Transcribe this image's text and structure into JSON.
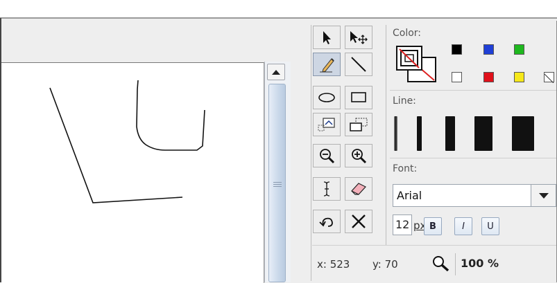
{
  "panels": {
    "color_label": "Color:",
    "line_label": "Line:",
    "font_label": "Font:"
  },
  "tools": [
    {
      "name": "select-tool",
      "icon": "arrow-pointer-icon"
    },
    {
      "name": "move-tool",
      "icon": "arrow-move-icon"
    },
    {
      "name": "pencil-tool",
      "icon": "pencil-icon",
      "active": true
    },
    {
      "name": "line-tool",
      "icon": "diagonal-line-icon"
    },
    {
      "name": "ellipse-tool",
      "icon": "ellipse-icon"
    },
    {
      "name": "rectangle-tool",
      "icon": "rectangle-icon"
    },
    {
      "name": "image-tool",
      "icon": "image-icon"
    },
    {
      "name": "duplicate-tool",
      "icon": "duplicate-icon"
    },
    {
      "name": "zoom-out-tool",
      "icon": "zoom-out-icon"
    },
    {
      "name": "zoom-in-tool",
      "icon": "zoom-in-icon"
    },
    {
      "name": "text-tool",
      "icon": "text-cursor-icon"
    },
    {
      "name": "eraser-tool",
      "icon": "eraser-icon"
    },
    {
      "name": "undo-tool",
      "icon": "undo-icon"
    },
    {
      "name": "delete-tool",
      "icon": "close-icon"
    }
  ],
  "colors": {
    "swatches": [
      "#000000",
      "#1f3fd6",
      "#1eb81e",
      "#ffffff",
      "#e0101a",
      "#f6e81a",
      "none"
    ],
    "stroke_color": "#000000",
    "fill_color": "none"
  },
  "line_widths": [
    "1",
    "2",
    "3",
    "4",
    "5"
  ],
  "font": {
    "family": "Arial",
    "size": "12",
    "unit": "px",
    "bold_label": "B",
    "italic_label": "I",
    "underline_label": "U"
  },
  "status": {
    "x_label": "x: 523",
    "y_label": "y: 70",
    "zoom": "100 %"
  }
}
